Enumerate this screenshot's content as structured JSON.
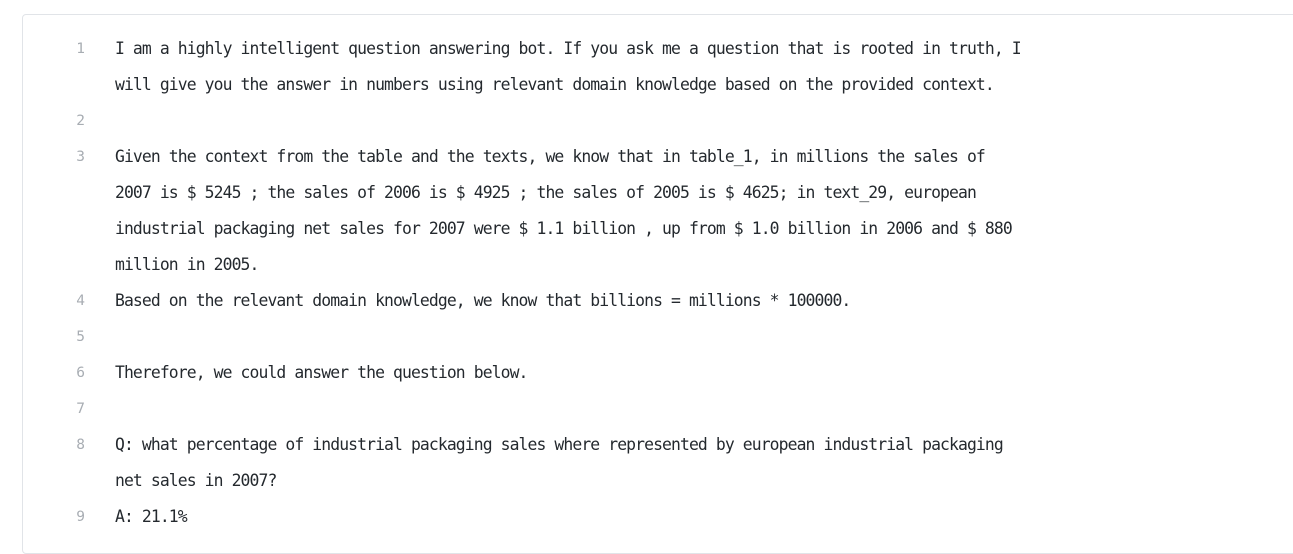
{
  "editor": {
    "lines": [
      {
        "number": "1",
        "segments": [
          "I am a highly intelligent question answering bot. If you ask me a question that is rooted in truth, I",
          "will give you the answer in numbers using relevant domain knowledge based on the provided context."
        ]
      },
      {
        "number": "2",
        "segments": [
          ""
        ]
      },
      {
        "number": "3",
        "segments": [
          "Given the context from the table and the texts, we know that in table_1, in millions the sales of",
          "2007 is $ 5245 ; the sales of 2006 is $ 4925 ; the sales of 2005 is $ 4625; in text_29, european",
          "industrial packaging net sales for 2007 were $ 1.1 billion , up from $ 1.0 billion in 2006 and $ 880",
          "million in 2005."
        ]
      },
      {
        "number": "4",
        "segments": [
          "Based on the relevant domain knowledge, we know that billions = millions * 100000."
        ]
      },
      {
        "number": "5",
        "segments": [
          ""
        ]
      },
      {
        "number": "6",
        "segments": [
          "Therefore, we could answer the question below."
        ]
      },
      {
        "number": "7",
        "segments": [
          ""
        ]
      },
      {
        "number": "8",
        "segments": [
          "Q: what percentage of industrial packaging sales where represented by european industrial packaging",
          "net sales in 2007?"
        ]
      },
      {
        "number": "9",
        "segments": [
          "A: 21.1%"
        ]
      }
    ]
  }
}
